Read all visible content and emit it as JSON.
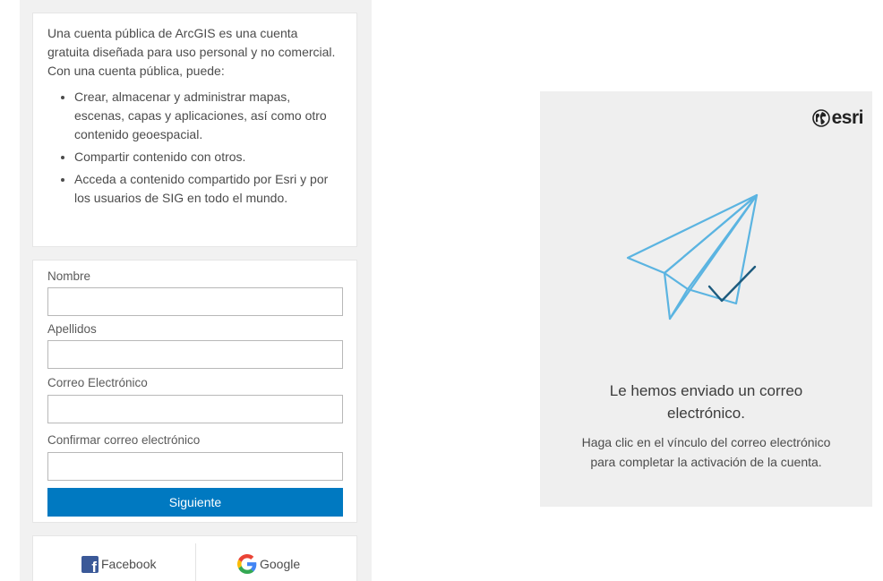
{
  "left": {
    "intro": {
      "p1": "Una cuenta pública de ArcGIS es una cuenta gratuita diseñada para uso personal y no comercial.",
      "p2": "Con una cuenta pública, puede:",
      "bullets": [
        "Crear, almacenar y administrar mapas, escenas, capas y aplicaciones, así como otro contenido geoespacial.",
        "Compartir contenido con otros.",
        "Acceda a contenido compartido por Esri y por los usuarios de SIG en todo el mundo."
      ]
    },
    "form": {
      "first_name_label": "Nombre",
      "first_name_value": "",
      "last_name_label": "Apellidos",
      "last_name_value": "",
      "email_label": "Correo Electrónico",
      "email_value": "",
      "confirm_email_label": "Confirmar correo electrónico",
      "confirm_email_value": "",
      "next_button": "Siguiente"
    },
    "social": {
      "facebook_label": "Facebook",
      "facebook_icon": "facebook-icon",
      "google_label": "Google",
      "google_icon": "google-icon"
    }
  },
  "right": {
    "logo_text": "esri",
    "logo_icon": "globe-icon",
    "illustration": "paper-plane-check-icon",
    "title_line1": "Le hemos enviado un correo",
    "title_line2": "electrónico.",
    "body_line1": "Haga clic en el vínculo del correo electrónico",
    "body_line2": "para completar la activación de la cuenta."
  },
  "colors": {
    "primary_button": "#0079c1",
    "plane_stroke": "#5bb4e1",
    "check_stroke": "#1c5a7d",
    "facebook": "#3b5998"
  }
}
